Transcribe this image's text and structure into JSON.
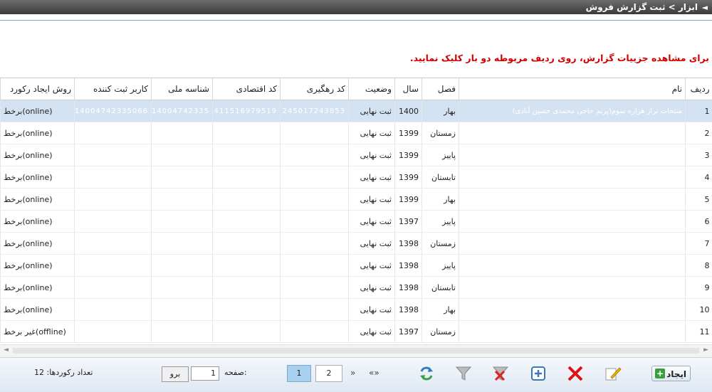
{
  "header": {
    "arrow": "◄",
    "title": "ابزار > ثبت گزارش فروش"
  },
  "hint": "برای مشاهده جزییات گزارش، روی ردیف مربوطه دو بار کلیک نمایید.",
  "columns": [
    "ردیف",
    "نام",
    "فصل",
    "سال",
    "وضعیت",
    "کد رهگیری",
    "کد اقتصادی",
    "شناسه ملی",
    "کاربر ثبت کننده",
    "روش ایجاد رکورد"
  ],
  "rows": [
    {
      "num": "1",
      "name": "منتجات تراز هزاره سوم(پرنم حاجی محمدی حسین آبادی)",
      "season": "بهار",
      "year": "1400",
      "status": "ثبت نهایی",
      "tracking": "245017243853",
      "economic": "411516979519",
      "national": "14004742335",
      "user": "14004742335066",
      "method": "(online)برخط",
      "selected": true
    },
    {
      "num": "2",
      "name": "",
      "season": "زمستان",
      "year": "1399",
      "status": "ثبت نهایی",
      "tracking": "",
      "economic": "",
      "national": "",
      "user": "",
      "method": "(online)برخط"
    },
    {
      "num": "3",
      "name": "",
      "season": "پاییز",
      "year": "1399",
      "status": "ثبت نهایی",
      "tracking": "",
      "economic": "",
      "national": "",
      "user": "",
      "method": "(online)برخط"
    },
    {
      "num": "4",
      "name": "",
      "season": "تابستان",
      "year": "1399",
      "status": "ثبت نهایی",
      "tracking": "",
      "economic": "",
      "national": "",
      "user": "",
      "method": "(online)برخط"
    },
    {
      "num": "5",
      "name": "",
      "season": "بهار",
      "year": "1399",
      "status": "ثبت نهایی",
      "tracking": "",
      "economic": "",
      "national": "",
      "user": "",
      "method": "(online)برخط"
    },
    {
      "num": "6",
      "name": "",
      "season": "پاییز",
      "year": "1397",
      "status": "ثبت نهایی",
      "tracking": "",
      "economic": "",
      "national": "",
      "user": "",
      "method": "(online)برخط"
    },
    {
      "num": "7",
      "name": "",
      "season": "زمستان",
      "year": "1398",
      "status": "ثبت نهایی",
      "tracking": "",
      "economic": "",
      "national": "",
      "user": "",
      "method": "(online)برخط"
    },
    {
      "num": "8",
      "name": "",
      "season": "پاییز",
      "year": "1398",
      "status": "ثبت نهایی",
      "tracking": "",
      "economic": "",
      "national": "",
      "user": "",
      "method": "(online)برخط"
    },
    {
      "num": "9",
      "name": "",
      "season": "تابستان",
      "year": "1398",
      "status": "ثبت نهایی",
      "tracking": "",
      "economic": "",
      "national": "",
      "user": "",
      "method": "(online)برخط"
    },
    {
      "num": "10",
      "name": "",
      "season": "بهار",
      "year": "1398",
      "status": "ثبت نهایی",
      "tracking": "",
      "economic": "",
      "national": "",
      "user": "",
      "method": "(online)برخط"
    },
    {
      "num": "11",
      "name": "",
      "season": "زمستان",
      "year": "1397",
      "status": "ثبت نهایی",
      "tracking": "",
      "economic": "",
      "national": "",
      "user": "",
      "method": "(offline)غیر برخط"
    }
  ],
  "footer": {
    "create_label": "ایجاد",
    "pages": [
      "1",
      "2"
    ],
    "nav_first": "»",
    "nav_prev": "«»",
    "page_label": "صفحه:",
    "page_value": "1",
    "go_label": "برو",
    "count_text": "تعداد رکوردها: 12"
  },
  "colors": {
    "accent": "#a9d0ee",
    "selected_row": "#d3e3f3",
    "hint": "#d40000",
    "titlebar": "#4a4a4a"
  }
}
